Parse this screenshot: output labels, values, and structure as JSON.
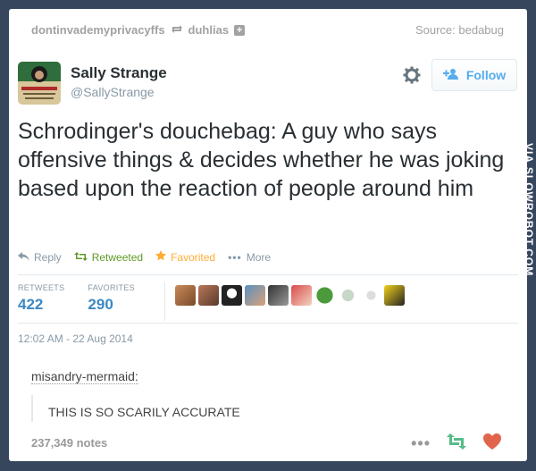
{
  "header": {
    "user_from": "dontinvademyprivacyffs",
    "user_to": "duhlias",
    "source": "Source: bedabug"
  },
  "tweet": {
    "name": "Sally Strange",
    "handle": "@SallyStrange",
    "follow_label": "Follow",
    "text": "Schrodinger's douchebag: A guy who says offensive things & decides whether he was joking based upon the reaction of people around him",
    "actions": {
      "reply": "Reply",
      "retweeted": "Retweeted",
      "favorited": "Favorited",
      "more": "More"
    },
    "stats": {
      "retweets_label": "RETWEETS",
      "retweets": "422",
      "favorites_label": "FAVORITES",
      "favorites": "290"
    },
    "timestamp": "12:02 AM - 22 Aug 2014"
  },
  "comment": {
    "user": "misandry-mermaid:",
    "text": "THIS IS SO SCARILY ACCURATE"
  },
  "footer": {
    "notes": "237,349 notes"
  },
  "watermark": "VIA SLOWROBOT.COM",
  "colors": {
    "accent": "#55acee",
    "retweet": "#609928",
    "favorite": "#ffac33",
    "heart": "#e0654c",
    "reblog": "#56bc8a",
    "background": "#36465d"
  }
}
